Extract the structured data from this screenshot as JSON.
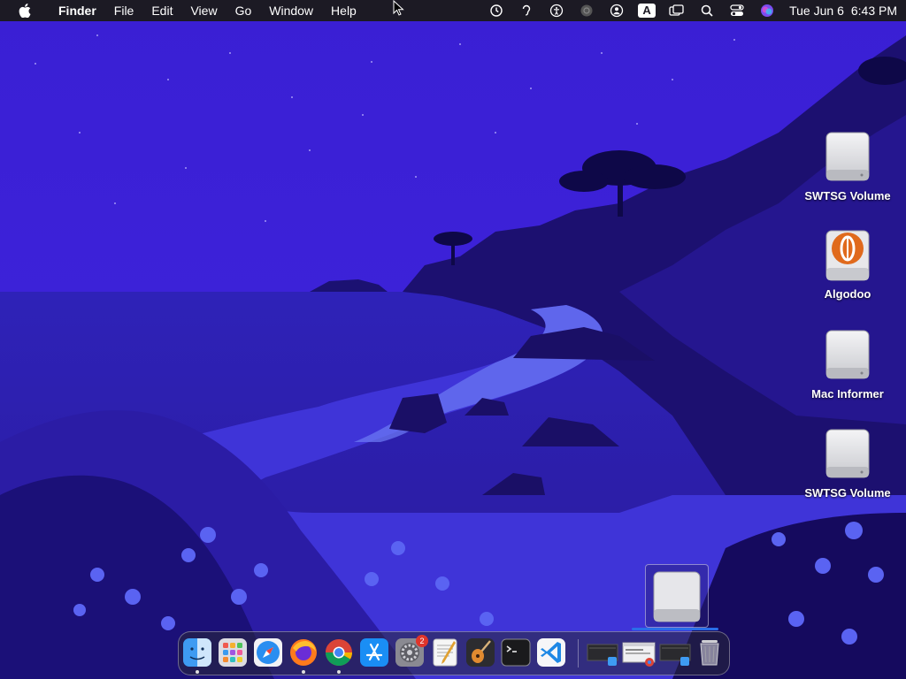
{
  "menubar": {
    "app_name": "Finder",
    "menus": [
      "File",
      "Edit",
      "View",
      "Go",
      "Window",
      "Help"
    ],
    "status_icons": [
      "time-machine-icon",
      "hearing-icon",
      "accessibility-icon",
      "airplay-icon",
      "user-icon",
      "input-source-icon",
      "screen-mirroring-icon",
      "spotlight-icon",
      "control-center-icon",
      "siri-icon"
    ],
    "input_source_label": "A",
    "date": "Tue Jun 6",
    "time": "6:43 PM"
  },
  "desktop": {
    "icons": [
      {
        "label": "SWTSG Volume",
        "icon": "external-drive-icon"
      },
      {
        "label": "Algodoo",
        "icon": "algodoo-installer-icon"
      },
      {
        "label": "Mac Informer",
        "icon": "external-drive-icon"
      },
      {
        "label": "SWTSG Volume",
        "icon": "external-drive-icon"
      }
    ]
  },
  "dock": {
    "apps": [
      {
        "name": "Finder",
        "running": true
      },
      {
        "name": "Launchpad",
        "running": false
      },
      {
        "name": "Safari",
        "running": false
      },
      {
        "name": "Firefox",
        "running": true
      },
      {
        "name": "Google Chrome",
        "running": true
      },
      {
        "name": "App Store",
        "running": false
      },
      {
        "name": "System Preferences",
        "running": false,
        "badge": "2"
      },
      {
        "name": "TextEdit",
        "running": false
      },
      {
        "name": "GarageBand",
        "running": false
      },
      {
        "name": "Terminal",
        "running": false
      },
      {
        "name": "Visual Studio Code",
        "running": false
      }
    ],
    "recent": [
      "Finder window thumbnail",
      "Chrome window thumbnail",
      "Finder window thumbnail"
    ],
    "trash": "Trash"
  },
  "colors": {
    "sky": "#3b1fd6",
    "sea": "#2a1ca8",
    "shore": "#6e7cf5",
    "land": "#1a0f66",
    "menubar": "#1c1a24"
  }
}
